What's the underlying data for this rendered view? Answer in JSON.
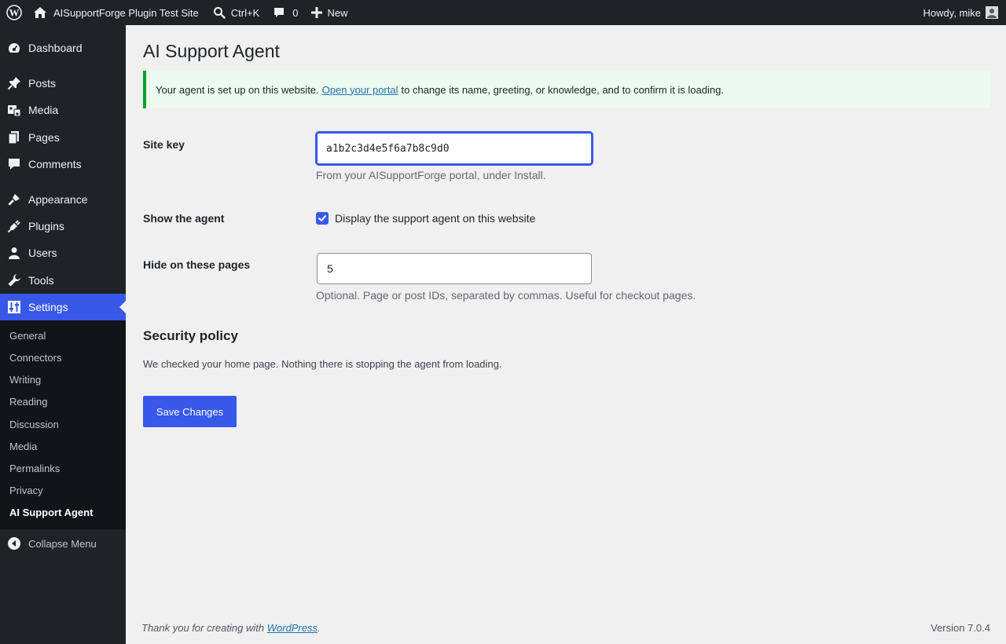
{
  "adminbar": {
    "site_name": "AISupportForge Plugin Test Site",
    "search_label": "Ctrl+K",
    "comments_count": "0",
    "new_label": "New",
    "greeting": "Howdy, mike"
  },
  "sidebar": {
    "items": {
      "dashboard": "Dashboard",
      "posts": "Posts",
      "media": "Media",
      "pages": "Pages",
      "comments": "Comments",
      "appearance": "Appearance",
      "plugins": "Plugins",
      "users": "Users",
      "tools": "Tools",
      "settings": "Settings"
    },
    "submenu": [
      "General",
      "Connectors",
      "Writing",
      "Reading",
      "Discussion",
      "Media",
      "Permalinks",
      "Privacy",
      "AI Support Agent"
    ],
    "collapse_label": "Collapse Menu"
  },
  "page": {
    "title": "AI Support Agent",
    "notice": {
      "before": "Your agent is set up on this website.",
      "link": "Open your portal",
      "after": "to change its name, greeting, or knowledge, and to confirm it is loading."
    },
    "site_key": {
      "label": "Site key",
      "value": "a1b2c3d4e5f6a7b8c9d0",
      "description": "From your AISupportForge portal, under Install."
    },
    "show_agent": {
      "label": "Show the agent",
      "checkbox_label": "Display the support agent on this website",
      "checked": true
    },
    "hide_pages": {
      "label": "Hide on these pages",
      "value": "5",
      "description": "Optional. Page or post IDs, separated by commas. Useful for checkout pages."
    },
    "security": {
      "title": "Security policy",
      "text": "We checked your home page. Nothing there is stopping the agent from loading."
    },
    "save_label": "Save Changes"
  },
  "footer": {
    "thanks_before": "Thank you for creating with",
    "thanks_link": "WordPress",
    "thanks_after": ".",
    "version": "Version 7.0.4"
  },
  "colors": {
    "accent": "#3858e9",
    "adminbar_bg": "#1d2327",
    "notice_border": "#00a32a"
  }
}
